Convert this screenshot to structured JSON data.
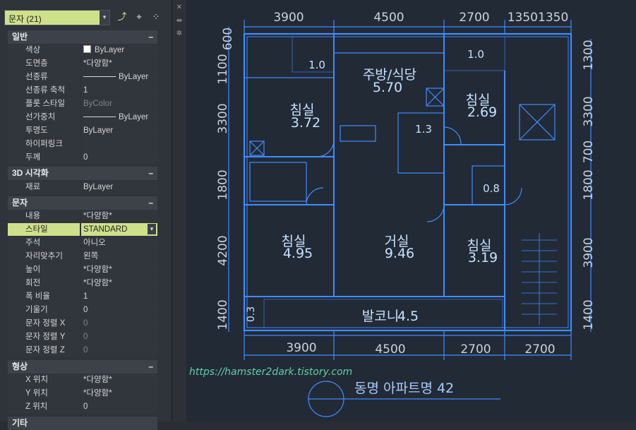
{
  "selector": {
    "value": "문자 (21)"
  },
  "toolbar": {
    "quick_select": "⤴",
    "pick_object": "⌖",
    "toggle_pickadd": "⁘"
  },
  "sections": {
    "general": {
      "title": "일반",
      "collapse": "–"
    },
    "visual3d": {
      "title": "3D 시각화",
      "collapse": "–"
    },
    "text": {
      "title": "문자",
      "collapse": "–"
    },
    "geometry": {
      "title": "형상",
      "collapse": "–"
    },
    "misc": {
      "title": "기타",
      "collapse": "–"
    }
  },
  "general_rows": [
    {
      "label": "색상",
      "value": "ByLayer"
    },
    {
      "label": "도면층",
      "value": "*다양함*"
    },
    {
      "label": "선종류",
      "value": "ByLayer"
    },
    {
      "label": "선종류 축척",
      "value": "1"
    },
    {
      "label": "플롯 스타일",
      "value": "ByColor"
    },
    {
      "label": "선가중치",
      "value": "ByLayer"
    },
    {
      "label": "투명도",
      "value": "ByLayer"
    },
    {
      "label": "하이퍼링크",
      "value": ""
    },
    {
      "label": "두께",
      "value": "0"
    }
  ],
  "visual_rows": [
    {
      "label": "재료",
      "value": "ByLayer"
    }
  ],
  "text_rows": [
    {
      "label": "내용",
      "value": "*다양함*"
    },
    {
      "label": "스타일",
      "value": "STANDARD"
    },
    {
      "label": "주석",
      "value": "아니오"
    },
    {
      "label": "자리맞추기",
      "value": "왼쪽"
    },
    {
      "label": "높이",
      "value": "*다양함*"
    },
    {
      "label": "회전",
      "value": "*다양함*"
    },
    {
      "label": "폭 비율",
      "value": "1"
    },
    {
      "label": "기울기",
      "value": "0"
    },
    {
      "label": "문자 정렬 X",
      "value": "0"
    },
    {
      "label": "문자 정렬 Y",
      "value": "0"
    },
    {
      "label": "문자 정렬 Z",
      "value": "0"
    }
  ],
  "geometry_rows": [
    {
      "label": "X 위치",
      "value": "*다양함*"
    },
    {
      "label": "Y 위치",
      "value": "*다양함*"
    },
    {
      "label": "Z 위치",
      "value": "0"
    }
  ],
  "drawing": {
    "top_dims": [
      "3900",
      "4500",
      "2700",
      "13501350"
    ],
    "bottom_dims": [
      "3900",
      "4500",
      "2700",
      "2700"
    ],
    "left_dims": [
      "600",
      "1100",
      "3300",
      "1800",
      "4200",
      "1400"
    ],
    "right_dims": [
      "1300",
      "3300",
      "700",
      "1800",
      "3900",
      "1400"
    ],
    "rooms": [
      {
        "name": "주방/식당",
        "area": "5.70"
      },
      {
        "name": "침실",
        "area": "3.72"
      },
      {
        "name": "침실",
        "area": "2.69"
      },
      {
        "name": "침실",
        "area": "4.95"
      },
      {
        "name": "거실",
        "area": "9.46"
      },
      {
        "name": "침실",
        "area": "3.19"
      },
      {
        "name": "발코니",
        "area": "4.5"
      }
    ],
    "small_areas": [
      "1.0",
      "1.0",
      "1.3",
      "0.8",
      "0.3"
    ],
    "watermark": "https://hamster2dark.tistory.com",
    "building_label": "동명 아파트명 42"
  },
  "colors": {
    "highlight": "#cfe08a",
    "plan_line": "#3f8cff",
    "background": "#222a36"
  }
}
